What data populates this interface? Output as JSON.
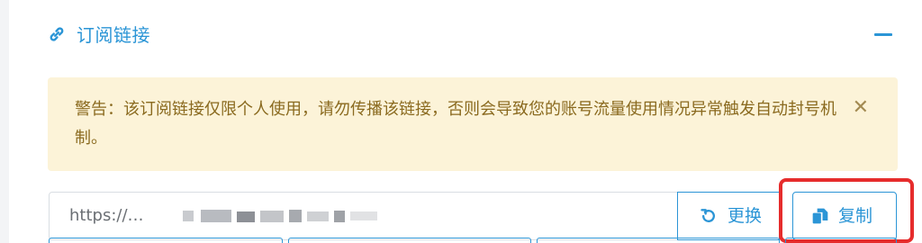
{
  "section": {
    "title": "订阅链接",
    "icon": "link-icon",
    "collapse_icon": "minus-icon"
  },
  "alert": {
    "text": "警告：该订阅链接仅限个人使用，请勿传播该链接，否则会导致您的账号流量使用情况异常触发自动封号机制。",
    "close_icon": "close-icon",
    "close_glyph": "✕"
  },
  "subscription": {
    "url_prefix": "https://…"
  },
  "buttons": {
    "refresh_label": "更换",
    "refresh_icon": "refresh-icon",
    "copy_label": "复制",
    "copy_icon": "copy-icon"
  },
  "colors": {
    "accent": "#2b95d6",
    "alert_bg": "#fcf3d8",
    "alert_text": "#8a6a1f",
    "highlight": "#e62c2c"
  }
}
